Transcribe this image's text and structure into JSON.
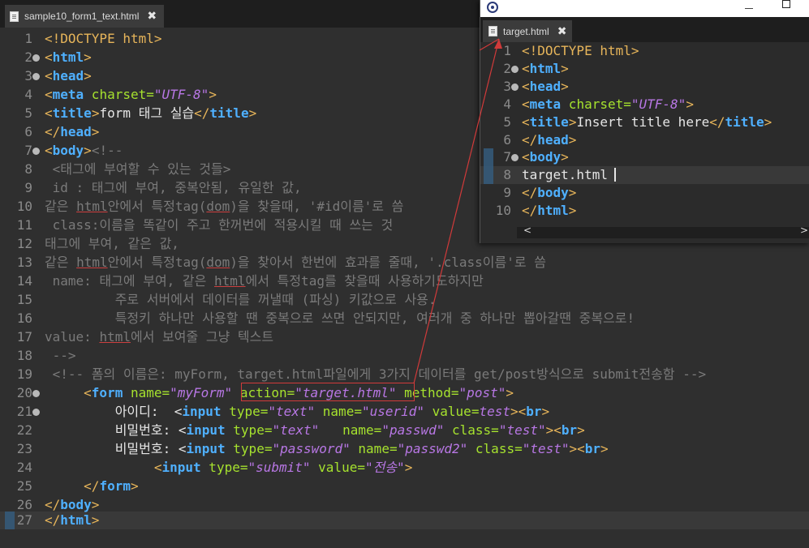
{
  "main": {
    "tab_label": "sample10_form1_text.html",
    "close": "✖",
    "line_numbers": [
      "1",
      "2",
      "3",
      "4",
      "5",
      "6",
      "7",
      "8",
      "9",
      "10",
      "11",
      "12",
      "13",
      "14",
      "15",
      "16",
      "17",
      "18",
      "19",
      "20",
      "21",
      "22",
      "23",
      "24",
      "25",
      "26",
      "27"
    ],
    "l1": [
      "<!DOCTYPE",
      " html>"
    ],
    "l2": [
      "<",
      "html",
      ">"
    ],
    "l3": [
      "<",
      "head",
      ">"
    ],
    "l4": [
      "<",
      "meta",
      " charset=",
      "\"UTF-8\"",
      ">"
    ],
    "l5": [
      "<",
      "title",
      ">",
      "form 태그 실습",
      "</",
      "title",
      ">"
    ],
    "l6": [
      "</",
      "head",
      ">"
    ],
    "l7": [
      "<",
      "body",
      ">",
      "<!--"
    ],
    "l8": " <태그에 부여할 수 있는 것들>",
    "l9": " id : 태그에 부여, 중복안됨, 유일한 값,",
    "l10": [
      "같은 ",
      "html",
      "안에서 특정tag(",
      "dom",
      ")을 찾을때, '#id이름'로 씀"
    ],
    "l11": " class:이름을 똑같이 주고 한꺼번에 적용시킬 때 쓰는 것",
    "l12": "태그에 부여, 같은 값,",
    "l13": [
      "같은 ",
      "html",
      "안에서 특정tag(",
      "dom",
      ")을 찾아서 한번에 효과를 줄때, '.class이름'로 씀"
    ],
    "l14": [
      " name: 태그에 부여, 같은 ",
      "html",
      "에서 특정tag를 찾을때 사용하기도하지만"
    ],
    "l15": "         주로 서버에서 데이터를 꺼낼때 (파싱) 키값으로 사용.",
    "l16": "         특정키 하나만 사용할 땐 중복으로 쓰면 안되지만, 여러개 중 하나만 뽑아갈땐 중복으로!",
    "l17": [
      "value: ",
      "html",
      "에서 보여줄 그냥 텍스트"
    ],
    "l18": " -->",
    "l19": " <!-- 폼의 이름은: myForm, target.html파일에게 3가지 데이터를 get/post방식으로 submit전송함 -->",
    "l20": [
      "     <",
      "form",
      " name=",
      "\"myForm\"",
      " action=",
      "\"target.html\"",
      " method=",
      "\"post\"",
      ">"
    ],
    "l21": [
      "         아이디:  <",
      "input",
      " type=",
      "\"text\"",
      " name=",
      "\"userid\"",
      " value=",
      "test",
      "><",
      "br",
      ">"
    ],
    "l22": [
      "         비밀번호: <",
      "input",
      " type=",
      "\"text\"",
      "   name=",
      "\"passwd\"",
      " class=",
      "\"test\"",
      "><",
      "br",
      ">"
    ],
    "l23": [
      "         비밀번호: <",
      "input",
      " type=",
      "\"password\"",
      " name=",
      "\"passwd2\"",
      " class=",
      "\"test\"",
      "><",
      "br",
      ">"
    ],
    "l24": [
      "              <",
      "input",
      " type=",
      "\"submit\"",
      " value=",
      "\"전송\"",
      ">"
    ],
    "l25": [
      "     </",
      "form",
      ">"
    ],
    "l26": [
      "</",
      "body",
      ">"
    ],
    "l27": [
      "</",
      "html",
      ">"
    ]
  },
  "target": {
    "tab_label": "target.html",
    "close": "✖",
    "line_numbers": [
      "1",
      "2",
      "3",
      "4",
      "5",
      "6",
      "7",
      "8",
      "9",
      "10"
    ],
    "l1": [
      "<!DOCTYPE",
      " html>"
    ],
    "l2": [
      "<",
      "html",
      ">"
    ],
    "l3": [
      "<",
      "head",
      ">"
    ],
    "l4": [
      "<",
      "meta",
      " charset=",
      "\"UTF-8\"",
      ">"
    ],
    "l5": [
      "<",
      "title",
      ">",
      "Insert title here",
      "</",
      "title",
      ">"
    ],
    "l6": [
      "</",
      "head",
      ">"
    ],
    "l7": [
      "<",
      "body",
      ">"
    ],
    "l8": "target.html",
    "l9": [
      "</",
      "body",
      ">"
    ],
    "l10": [
      "</",
      "html",
      ">"
    ],
    "scroll_left": "<",
    "scroll_right": ">"
  }
}
